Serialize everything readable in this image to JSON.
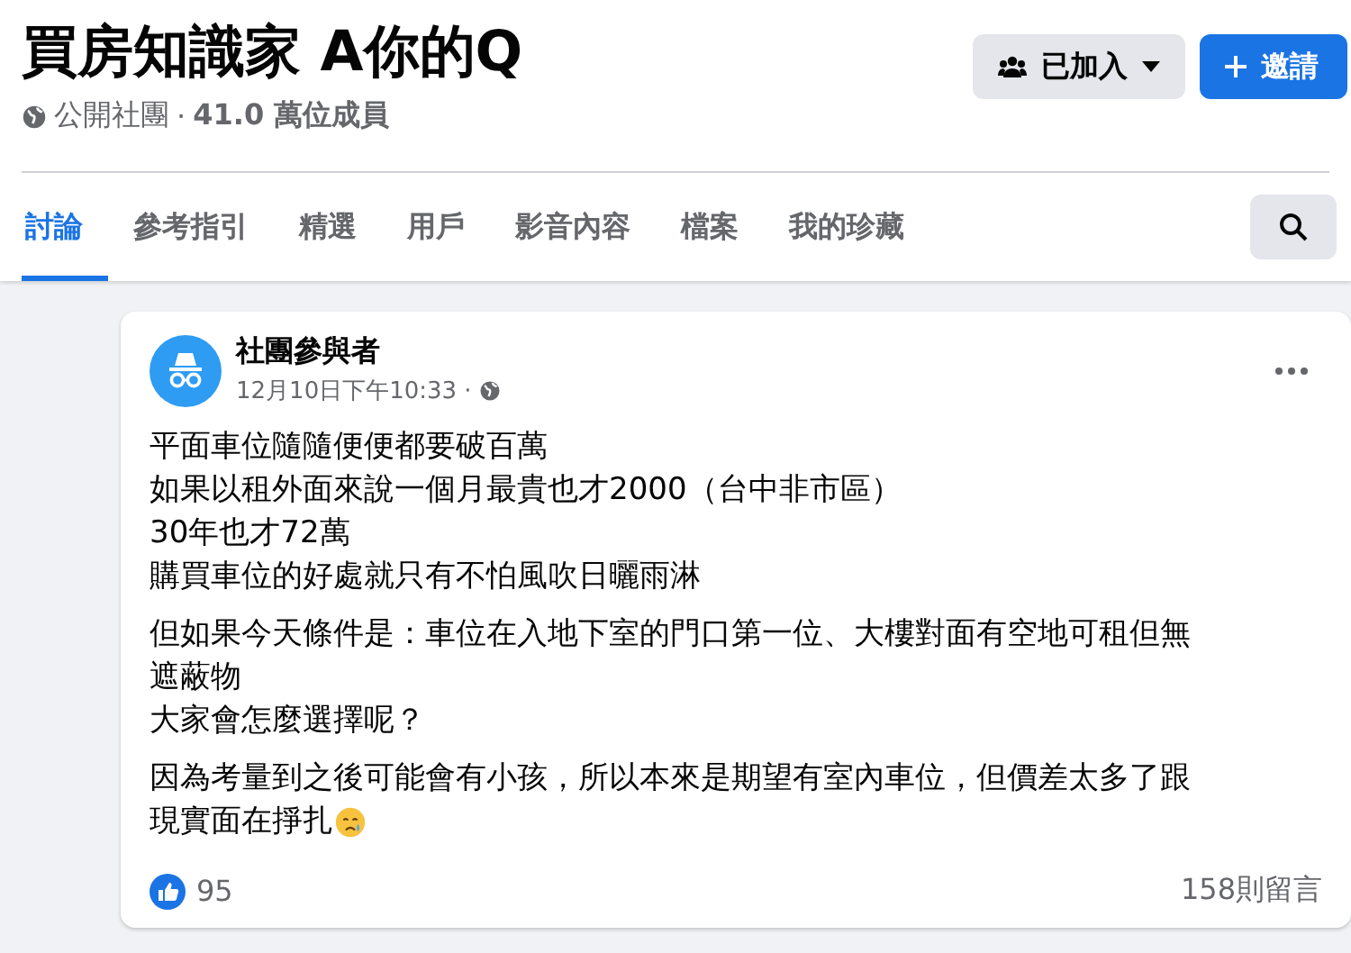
{
  "group": {
    "title": "買房知識家 A你的Q",
    "privacy": "公開社團",
    "separator": "·",
    "members": "41.0 萬位成員"
  },
  "actions": [
    {
      "kind": "joined",
      "label": "已加入"
    },
    {
      "kind": "invite",
      "label": "邀請"
    }
  ],
  "tabs": [
    {
      "label": "討論",
      "selected": true
    },
    {
      "label": "參考指引",
      "selected": false
    },
    {
      "label": "精選",
      "selected": false
    },
    {
      "label": "用戶",
      "selected": false
    },
    {
      "label": "影音內容",
      "selected": false
    },
    {
      "label": "檔案",
      "selected": false
    },
    {
      "label": "我的珍藏",
      "selected": false
    }
  ],
  "post": {
    "author": "社團參與者",
    "time": "12月10日下午10:33",
    "separator": "·",
    "paragraphs": [
      [
        "平面車位隨隨便便都要破百萬",
        "如果以租外面來說一個月最貴也才2000（台中非市區）",
        "30年也才72萬",
        "購買車位的好處就只有不怕風吹日曬雨淋"
      ],
      [
        "但如果今天條件是：車位在入地下室的門口第一位、大樓對面有空地可租但無",
        "遮蔽物",
        "大家會怎麼選擇呢？"
      ],
      [
        "因為考量到之後可能會有小孩，所以本來是期望有室內車位，但價差太多了跟",
        "現實面在掙扎"
      ]
    ],
    "likes": "95",
    "comments": "158則留言"
  }
}
